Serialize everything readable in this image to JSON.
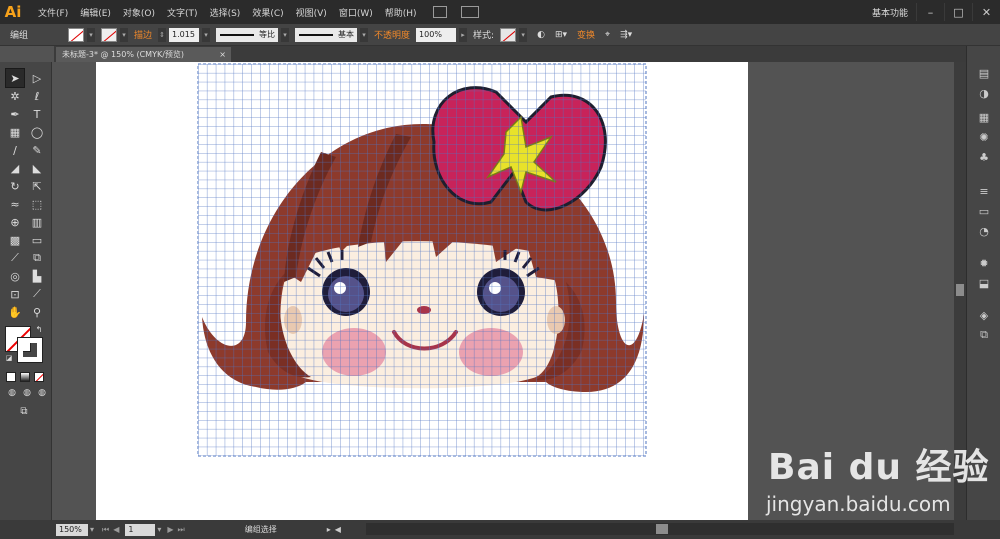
{
  "app": {
    "logo": "Ai"
  },
  "menubar": {
    "items": [
      "文件(F)",
      "编辑(E)",
      "对象(O)",
      "文字(T)",
      "选择(S)",
      "效果(C)",
      "视图(V)",
      "窗口(W)",
      "帮助(H)"
    ],
    "workspace": "基本功能",
    "window_controls": [
      "–",
      "□",
      "✕"
    ]
  },
  "control_bar": {
    "selection_label": "编组",
    "stroke_label": "描边",
    "stroke_weight": "1.015",
    "stroke_profile": "等比",
    "brush": "基本",
    "opacity_label": "不透明度",
    "opacity_value": "100%",
    "style_label": "样式:",
    "transform_label": "变换"
  },
  "document_tab": {
    "title": "未标题-3* @ 150% (CMYK/预览)",
    "close": "×"
  },
  "status_bar": {
    "zoom": "150%",
    "page": "1",
    "status_text": "编组选择"
  },
  "watermark": {
    "brand": "Bai du 经验",
    "url": "jingyan.baidu.com"
  },
  "colors": {
    "hair": "#8d3a2c",
    "hair_dark": "#7a2f24",
    "skin": "#fbeee0",
    "cheek": "#eba2b0",
    "bow": "#c8235a",
    "bow_ribbon": "#e8e22a",
    "grid": "#5577bb",
    "ui_accent": "#f0882a"
  }
}
